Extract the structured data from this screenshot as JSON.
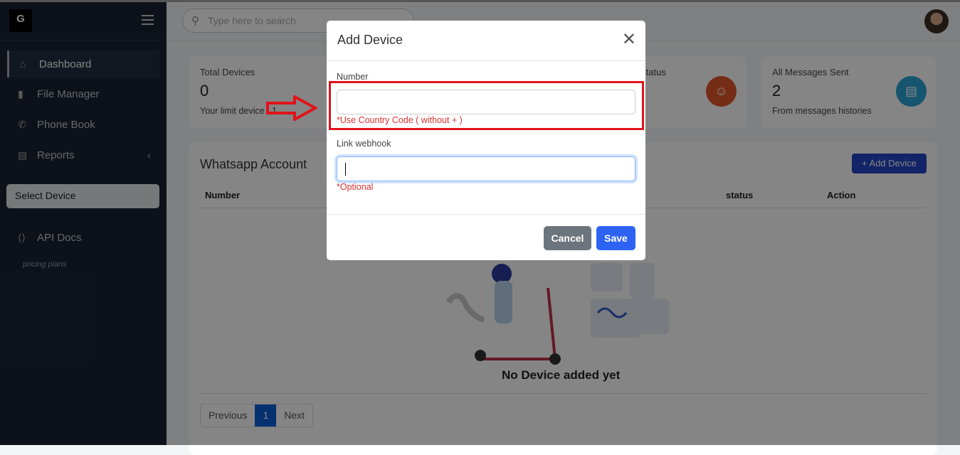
{
  "sidebar": {
    "logo": "G",
    "items": [
      {
        "label": "Dashboard",
        "icon": "home-icon"
      },
      {
        "label": "File Manager",
        "icon": "file-icon"
      },
      {
        "label": "Phone Book",
        "icon": "phone-icon"
      },
      {
        "label": "Reports",
        "icon": "report-icon"
      }
    ],
    "select_device": "Select Device",
    "api_docs": "API Docs",
    "pricing": "pricing plans"
  },
  "header": {
    "search_placeholder": "Type here to search"
  },
  "cards": [
    {
      "title": "Total Devices",
      "value": "0",
      "sub": "Your limit device : 1"
    },
    {
      "title": "Status"
    },
    {
      "title": "All Messages Sent",
      "value": "2",
      "sub": "From messages histories"
    }
  ],
  "panel": {
    "title": "Whatsapp Account",
    "add_button": "+ Add Device",
    "columns": [
      "Number",
      "status",
      "Action"
    ],
    "empty": "No Device added yet",
    "pagination": {
      "previous": "Previous",
      "current": "1",
      "next": "Next"
    }
  },
  "modal": {
    "title": "Add Device",
    "number_label": "Number",
    "number_value": "",
    "number_hint": "*Use Country Code ( without + )",
    "webhook_label": "Link webhook",
    "webhook_value": "",
    "webhook_hint": "*Optional",
    "cancel": "Cancel",
    "save": "Save"
  },
  "colors": {
    "primary": "#2d63f3",
    "annotation": "#e0131b",
    "status_icon": "#e2562a",
    "messages_icon": "#2aa3d6"
  }
}
